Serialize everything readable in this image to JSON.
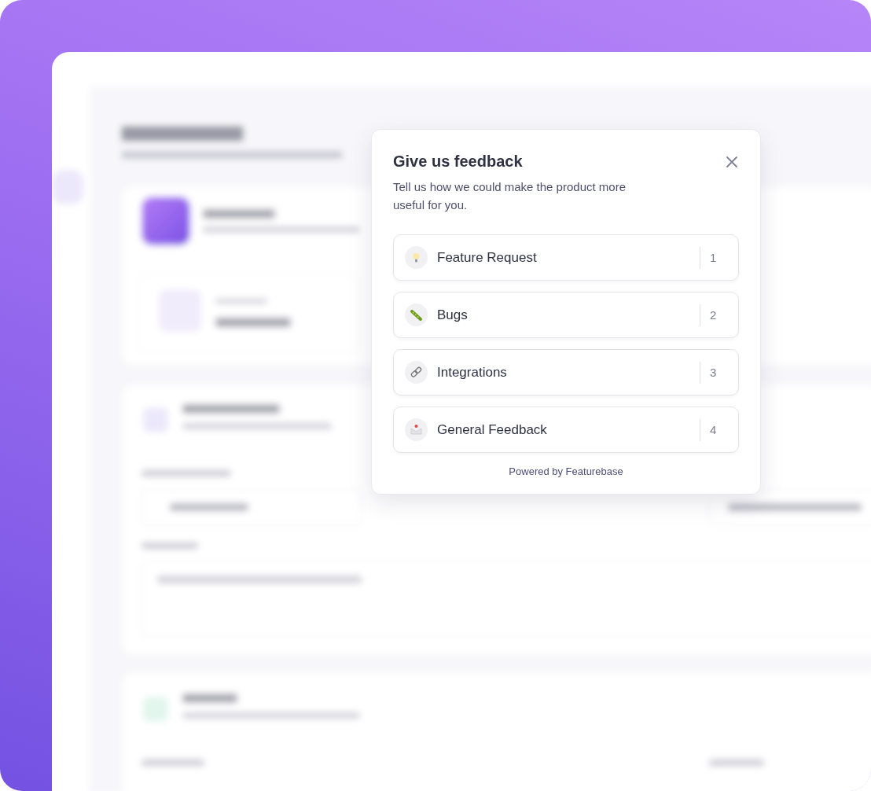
{
  "dialog": {
    "title": "Give us feedback",
    "subtitle": "Tell us how we could make the product more useful for you.",
    "categories": [
      {
        "kind": "idea",
        "label": "Feature Request",
        "number": "1"
      },
      {
        "kind": "bug",
        "label": "Bugs",
        "number": "2"
      },
      {
        "kind": "link",
        "label": "Integrations",
        "number": "3"
      },
      {
        "kind": "mail",
        "label": "General Feedback",
        "number": "4"
      }
    ],
    "footer": "Powered by Featurebase"
  }
}
